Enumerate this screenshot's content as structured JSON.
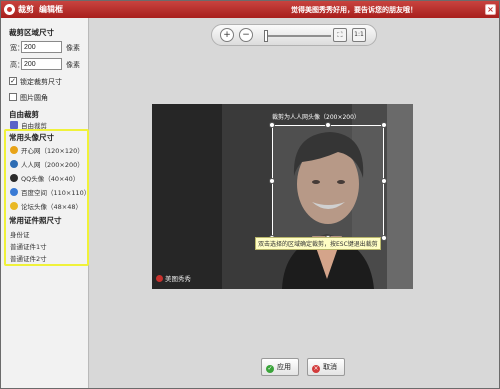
{
  "window": {
    "app_title": "裁剪",
    "subtitle": "编辑框",
    "promo": "觉得美图秀秀好用，要告诉您的朋友哦！",
    "close_glyph": "×"
  },
  "sidebar": {
    "crop_size_title": "裁剪区域尺寸",
    "width_label": "宽：",
    "width_value": "200",
    "height_label": "高：",
    "height_value": "200",
    "unit": "像素",
    "lock_label": "锁定裁剪尺寸",
    "lock_checked": true,
    "rounded_label": "图片圆角",
    "rounded_checked": false,
    "free_title": "自由裁剪",
    "free_item": "自由裁剪",
    "avatar_title": "常用头像尺寸",
    "avatars": [
      {
        "label": "开心网（120×120）",
        "icon": "kaixin-icon",
        "color": "#e8a317"
      },
      {
        "label": "人人网（200×200）",
        "icon": "renren-icon",
        "color": "#2e6db4"
      },
      {
        "label": "QQ头像（40×40）",
        "icon": "qq-icon",
        "color": "#2b2b2b"
      },
      {
        "label": "百度空间（110×110）",
        "icon": "baidu-icon",
        "color": "#3a7bd5"
      },
      {
        "label": "论坛头像（48×48）",
        "icon": "forum-icon",
        "color": "#e9b824"
      }
    ],
    "id_title": "常用证件照尺寸",
    "id_items": [
      "身份证",
      "普通证件1寸",
      "普通证件2寸"
    ]
  },
  "toolbar": {
    "zoom_in": "+",
    "zoom_out": "−",
    "fit_label": "⛶",
    "actual_label": "1:1"
  },
  "canvas": {
    "crop_label": "裁剪为人人网头像（200×200）",
    "tip": "双击选择的区域确定裁剪，按ESC键退出裁剪",
    "watermark": "美图秀秀"
  },
  "buttons": {
    "apply": "应用",
    "cancel": "取消"
  }
}
